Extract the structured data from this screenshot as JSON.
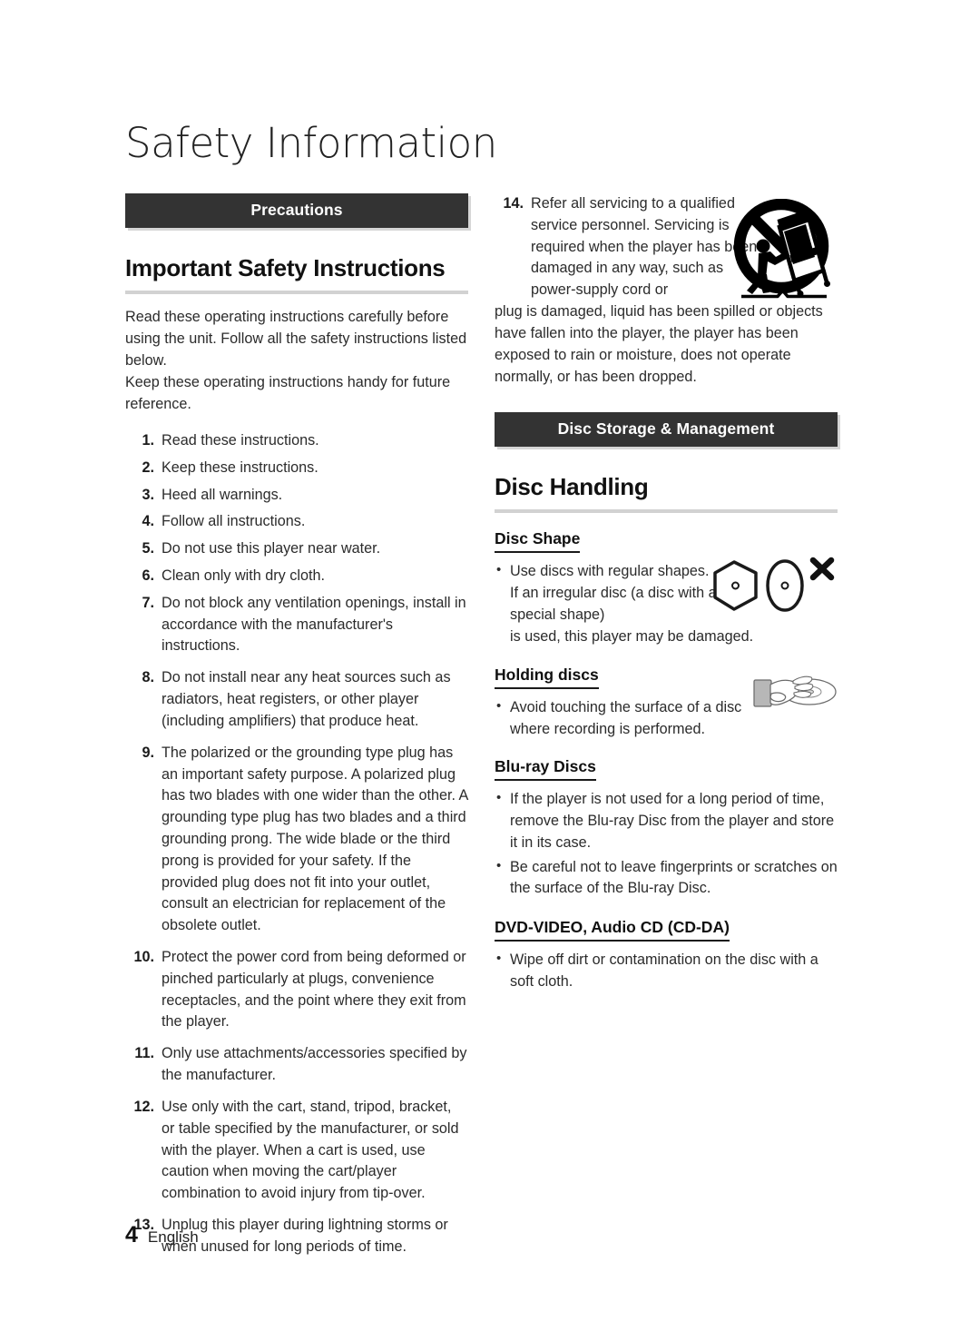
{
  "page": {
    "title": "Safety Information",
    "footer_page_number": "4",
    "footer_language": "English",
    "accent_bar_color": "#333333",
    "rule_color": "#d2d2d2"
  },
  "left_column": {
    "section_bar": "Precautions",
    "heading": "Important Safety Instructions",
    "intro_paragraphs": [
      "Read these operating instructions carefully before using the unit. Follow all the safety instructions listed below.",
      "Keep these operating instructions handy for future reference."
    ],
    "instructions": [
      {
        "num": "1.",
        "text": "Read these instructions."
      },
      {
        "num": "2.",
        "text": "Keep these instructions."
      },
      {
        "num": "3.",
        "text": "Heed all warnings."
      },
      {
        "num": "4.",
        "text": "Follow all instructions."
      },
      {
        "num": "5.",
        "text": "Do not use this player near water."
      },
      {
        "num": "6.",
        "text": "Clean only with dry cloth."
      },
      {
        "num": "7.",
        "text": "Do not block any ventilation openings, install in accordance with the manufacturer's instructions."
      },
      {
        "num": "8.",
        "text": "Do not install near any heat sources such as radiators, heat registers, or other player (including amplifiers) that produce heat."
      },
      {
        "num": "9.",
        "text": "The polarized or the grounding type plug has an important safety purpose. A polarized plug has two blades with one wider than the other. A grounding type plug has two blades and a third grounding prong. The wide blade or the third prong is provided for your safety. If the provided plug does not fit into your outlet, consult an electrician for replacement of the obsolete outlet."
      },
      {
        "num": "10.",
        "text": "Protect the power cord from being deformed or pinched particularly at plugs, convenience receptacles, and the point where they exit from the player."
      },
      {
        "num": "11.",
        "text": "Only use attachments/accessories specified by the manufacturer."
      },
      {
        "num": "12.",
        "text": "Use only with the cart, stand, tripod, bracket, or table specified by the manufacturer, or sold with the player. When a cart is used, use caution when moving the cart/player combination to avoid injury from tip-over."
      },
      {
        "num": "13.",
        "text": "Unplug this player during lightning storms or when unused for long periods of time."
      }
    ]
  },
  "right_column": {
    "item_14": {
      "num": "14.",
      "text_beside_figure": "Refer all servicing to a qualified service personnel. Servicing is required when the player has been damaged in any way, such as power-supply cord or",
      "text_full_width": "plug is damaged, liquid has been spilled or objects have fallen into the player, the player has been exposed to rain or moisture, does not operate normally, or has been dropped."
    },
    "section_bar": "Disc Storage & Management",
    "heading": "Disc Handling",
    "subsections": [
      {
        "title": "Disc Shape",
        "bullets_beside_figure": [
          "Use discs with regular shapes. If an irregular disc (a disc with a special shape)"
        ],
        "bullet_full_width": "is used, this player may be damaged."
      },
      {
        "title": "Holding discs",
        "bullets": [
          "Avoid touching the surface of a disc where recording is performed."
        ]
      },
      {
        "title": "Blu-ray Discs",
        "bullets": [
          "If the player is not used for a long period of time, remove the Blu-ray Disc from the player and store it in its case.",
          "Be careful not to leave fingerprints or scratches on the surface of the Blu-ray Disc."
        ]
      },
      {
        "title": "DVD-VIDEO, Audio CD (CD-DA)",
        "bullets": [
          "Wipe off dirt or contamination on the disc with a soft cloth."
        ]
      }
    ]
  },
  "figures": {
    "cart_tipover_warning": "no-cart-tipover-warning-icon",
    "irregular_disc_shapes": "irregular-disc-shapes-icon",
    "holding_disc_hand": "hand-holding-disc-icon"
  }
}
